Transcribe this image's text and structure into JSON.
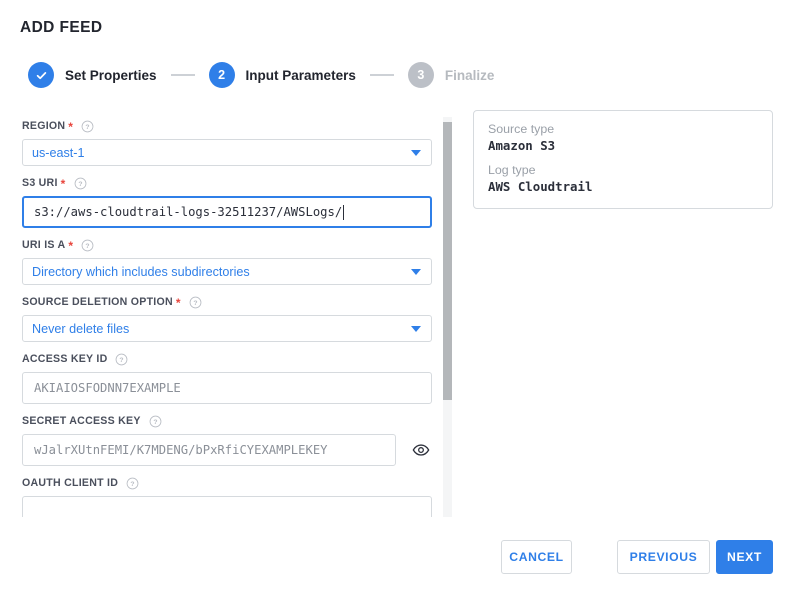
{
  "page_title": "ADD FEED",
  "colors": {
    "accent": "#2f7fe8",
    "required": "#e8453c",
    "pending": "#bcc0c7",
    "border": "#d6dade",
    "text": "#22252e",
    "muted": "#9aa0a8"
  },
  "stepper": {
    "steps": [
      {
        "number": "1",
        "label": "Set Properties",
        "state": "done",
        "glyph": "check-icon"
      },
      {
        "number": "2",
        "label": "Input Parameters",
        "state": "active",
        "glyph": "2"
      },
      {
        "number": "3",
        "label": "Finalize",
        "state": "pending",
        "glyph": "3"
      }
    ]
  },
  "form": {
    "fields": [
      {
        "id": "region",
        "label": "REGION",
        "required": true,
        "help_icon": "help-circle-icon",
        "type": "select",
        "value": "us-east-1"
      },
      {
        "id": "s3_uri",
        "label": "S3 URI",
        "required": true,
        "help_icon": "help-circle-icon",
        "type": "text",
        "focused": true,
        "value": "s3://aws-cloudtrail-logs-32511237/AWSLogs/",
        "placeholder": ""
      },
      {
        "id": "uri_is_a",
        "label": "URI IS A",
        "required": true,
        "help_icon": "help-circle-icon",
        "type": "select",
        "value": "Directory which includes subdirectories"
      },
      {
        "id": "source_deletion_option",
        "label": "SOURCE DELETION OPTION",
        "required": true,
        "help_icon": "help-circle-icon",
        "type": "select",
        "value": "Never delete files"
      },
      {
        "id": "access_key_id",
        "label": "ACCESS KEY ID",
        "required": false,
        "help_icon": "help-circle-icon",
        "type": "text",
        "value": "",
        "placeholder": "AKIAIOSFODNN7EXAMPLE"
      },
      {
        "id": "secret_access_key",
        "label": "SECRET ACCESS KEY",
        "required": false,
        "help_icon": "help-circle-icon",
        "type": "password",
        "value": "",
        "placeholder": "wJalrXUtnFEMI/K7MDENG/bPxRfiCYEXAMPLEKEY",
        "reveal_icon": "eye-icon"
      },
      {
        "id": "oauth_client_id",
        "label": "OAUTH CLIENT ID",
        "required": false,
        "help_icon": "help-circle-icon",
        "type": "text",
        "value": "",
        "placeholder": ""
      }
    ]
  },
  "info_panel": {
    "rows": [
      {
        "key": "Source type",
        "value": "Amazon S3"
      },
      {
        "key": "Log type",
        "value": "AWS Cloudtrail"
      }
    ]
  },
  "footer": {
    "cancel_label": "CANCEL",
    "previous_label": "PREVIOUS",
    "next_label": "NEXT"
  }
}
